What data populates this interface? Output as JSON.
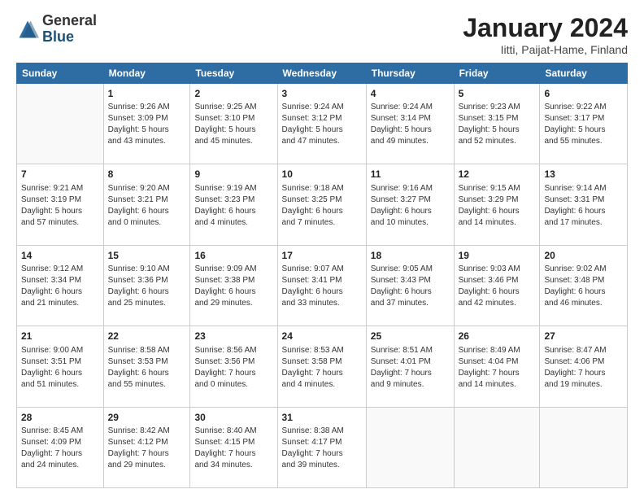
{
  "header": {
    "logo_general": "General",
    "logo_blue": "Blue",
    "title": "January 2024",
    "subtitle": "Iitti, Paijat-Hame, Finland"
  },
  "weekdays": [
    "Sunday",
    "Monday",
    "Tuesday",
    "Wednesday",
    "Thursday",
    "Friday",
    "Saturday"
  ],
  "weeks": [
    [
      {
        "day": "",
        "info": ""
      },
      {
        "day": "1",
        "info": "Sunrise: 9:26 AM\nSunset: 3:09 PM\nDaylight: 5 hours\nand 43 minutes."
      },
      {
        "day": "2",
        "info": "Sunrise: 9:25 AM\nSunset: 3:10 PM\nDaylight: 5 hours\nand 45 minutes."
      },
      {
        "day": "3",
        "info": "Sunrise: 9:24 AM\nSunset: 3:12 PM\nDaylight: 5 hours\nand 47 minutes."
      },
      {
        "day": "4",
        "info": "Sunrise: 9:24 AM\nSunset: 3:14 PM\nDaylight: 5 hours\nand 49 minutes."
      },
      {
        "day": "5",
        "info": "Sunrise: 9:23 AM\nSunset: 3:15 PM\nDaylight: 5 hours\nand 52 minutes."
      },
      {
        "day": "6",
        "info": "Sunrise: 9:22 AM\nSunset: 3:17 PM\nDaylight: 5 hours\nand 55 minutes."
      }
    ],
    [
      {
        "day": "7",
        "info": "Sunrise: 9:21 AM\nSunset: 3:19 PM\nDaylight: 5 hours\nand 57 minutes."
      },
      {
        "day": "8",
        "info": "Sunrise: 9:20 AM\nSunset: 3:21 PM\nDaylight: 6 hours\nand 0 minutes."
      },
      {
        "day": "9",
        "info": "Sunrise: 9:19 AM\nSunset: 3:23 PM\nDaylight: 6 hours\nand 4 minutes."
      },
      {
        "day": "10",
        "info": "Sunrise: 9:18 AM\nSunset: 3:25 PM\nDaylight: 6 hours\nand 7 minutes."
      },
      {
        "day": "11",
        "info": "Sunrise: 9:16 AM\nSunset: 3:27 PM\nDaylight: 6 hours\nand 10 minutes."
      },
      {
        "day": "12",
        "info": "Sunrise: 9:15 AM\nSunset: 3:29 PM\nDaylight: 6 hours\nand 14 minutes."
      },
      {
        "day": "13",
        "info": "Sunrise: 9:14 AM\nSunset: 3:31 PM\nDaylight: 6 hours\nand 17 minutes."
      }
    ],
    [
      {
        "day": "14",
        "info": "Sunrise: 9:12 AM\nSunset: 3:34 PM\nDaylight: 6 hours\nand 21 minutes."
      },
      {
        "day": "15",
        "info": "Sunrise: 9:10 AM\nSunset: 3:36 PM\nDaylight: 6 hours\nand 25 minutes."
      },
      {
        "day": "16",
        "info": "Sunrise: 9:09 AM\nSunset: 3:38 PM\nDaylight: 6 hours\nand 29 minutes."
      },
      {
        "day": "17",
        "info": "Sunrise: 9:07 AM\nSunset: 3:41 PM\nDaylight: 6 hours\nand 33 minutes."
      },
      {
        "day": "18",
        "info": "Sunrise: 9:05 AM\nSunset: 3:43 PM\nDaylight: 6 hours\nand 37 minutes."
      },
      {
        "day": "19",
        "info": "Sunrise: 9:03 AM\nSunset: 3:46 PM\nDaylight: 6 hours\nand 42 minutes."
      },
      {
        "day": "20",
        "info": "Sunrise: 9:02 AM\nSunset: 3:48 PM\nDaylight: 6 hours\nand 46 minutes."
      }
    ],
    [
      {
        "day": "21",
        "info": "Sunrise: 9:00 AM\nSunset: 3:51 PM\nDaylight: 6 hours\nand 51 minutes."
      },
      {
        "day": "22",
        "info": "Sunrise: 8:58 AM\nSunset: 3:53 PM\nDaylight: 6 hours\nand 55 minutes."
      },
      {
        "day": "23",
        "info": "Sunrise: 8:56 AM\nSunset: 3:56 PM\nDaylight: 7 hours\nand 0 minutes."
      },
      {
        "day": "24",
        "info": "Sunrise: 8:53 AM\nSunset: 3:58 PM\nDaylight: 7 hours\nand 4 minutes."
      },
      {
        "day": "25",
        "info": "Sunrise: 8:51 AM\nSunset: 4:01 PM\nDaylight: 7 hours\nand 9 minutes."
      },
      {
        "day": "26",
        "info": "Sunrise: 8:49 AM\nSunset: 4:04 PM\nDaylight: 7 hours\nand 14 minutes."
      },
      {
        "day": "27",
        "info": "Sunrise: 8:47 AM\nSunset: 4:06 PM\nDaylight: 7 hours\nand 19 minutes."
      }
    ],
    [
      {
        "day": "28",
        "info": "Sunrise: 8:45 AM\nSunset: 4:09 PM\nDaylight: 7 hours\nand 24 minutes."
      },
      {
        "day": "29",
        "info": "Sunrise: 8:42 AM\nSunset: 4:12 PM\nDaylight: 7 hours\nand 29 minutes."
      },
      {
        "day": "30",
        "info": "Sunrise: 8:40 AM\nSunset: 4:15 PM\nDaylight: 7 hours\nand 34 minutes."
      },
      {
        "day": "31",
        "info": "Sunrise: 8:38 AM\nSunset: 4:17 PM\nDaylight: 7 hours\nand 39 minutes."
      },
      {
        "day": "",
        "info": ""
      },
      {
        "day": "",
        "info": ""
      },
      {
        "day": "",
        "info": ""
      }
    ]
  ]
}
